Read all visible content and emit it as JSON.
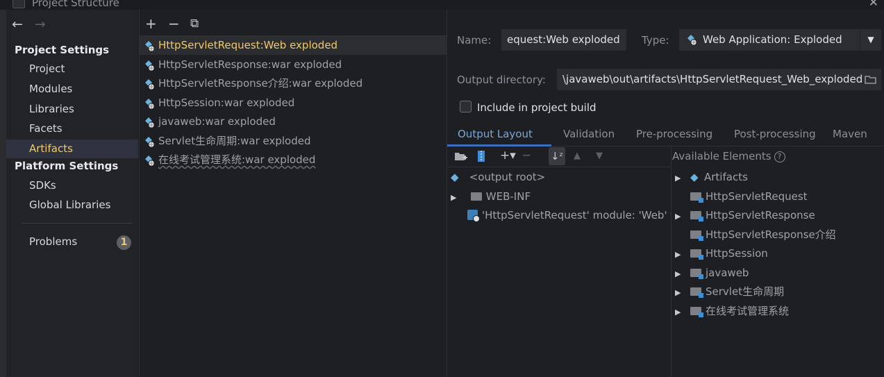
{
  "window": {
    "title": "Project Structure",
    "close_glyph": "✕"
  },
  "nav": {
    "back": "←",
    "forward": "→"
  },
  "sidebar": {
    "project_settings_header": "Project Settings",
    "project_items": [
      {
        "label": "Project"
      },
      {
        "label": "Modules"
      },
      {
        "label": "Libraries"
      },
      {
        "label": "Facets"
      },
      {
        "label": "Artifacts"
      }
    ],
    "platform_settings_header": "Platform Settings",
    "platform_items": [
      {
        "label": "SDKs"
      },
      {
        "label": "Global Libraries"
      }
    ],
    "problems": {
      "label": "Problems",
      "count": "1"
    },
    "selected_color": "#f0c96a"
  },
  "artifacts_toolbar": {
    "add": "+",
    "remove": "−",
    "copy": "⧉"
  },
  "artifacts": [
    {
      "label": "HttpServletRequest:Web exploded"
    },
    {
      "label": "HttpServletResponse:war exploded"
    },
    {
      "label": "HttpServletResponse介绍:war exploded"
    },
    {
      "label": "HttpSession:war exploded"
    },
    {
      "label": "javaweb:war exploded"
    },
    {
      "label": "Servlet生命周期:war exploded"
    },
    {
      "label": "在线考试管理系统:war exploded"
    }
  ],
  "detail": {
    "name_label": "Name:",
    "name_value": "equest:Web exploded",
    "type_label": "Type:",
    "type_value": "Web Application: Exploded",
    "output_dir_label": "Output directory:",
    "output_dir_value": "\\javaweb\\out\\artifacts\\HttpServletRequest_Web_exploded",
    "include_label": "Include in project build",
    "include_checked": false
  },
  "tabs": [
    {
      "label": "Output Layout"
    },
    {
      "label": "Validation"
    },
    {
      "label": "Pre-processing"
    },
    {
      "label": "Post-processing"
    },
    {
      "label": "Maven"
    }
  ],
  "layout_tree": {
    "root": "<output root>",
    "web_inf": "WEB-INF",
    "module_entry": "'HttpServletRequest' module: 'Web' f"
  },
  "available_elements": {
    "header": "Available Elements",
    "help": "?",
    "artifacts_node": "Artifacts",
    "items": [
      {
        "label": "HttpServletRequest",
        "expandable": false
      },
      {
        "label": "HttpServletResponse",
        "expandable": true
      },
      {
        "label": "HttpServletResponse介绍",
        "expandable": false
      },
      {
        "label": "HttpSession",
        "expandable": true
      },
      {
        "label": "javaweb",
        "expandable": true
      },
      {
        "label": "Servlet生命周期",
        "expandable": true
      },
      {
        "label": "在线考试管理系统",
        "expandable": true
      }
    ]
  }
}
